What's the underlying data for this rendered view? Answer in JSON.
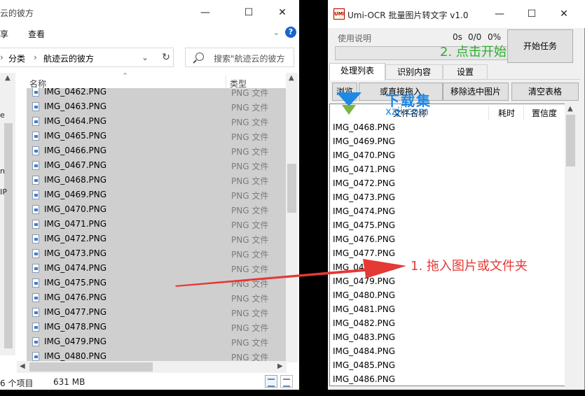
{
  "explorer": {
    "title": "云的彼方",
    "menu": [
      "享",
      "查看"
    ],
    "breadcrumb": [
      "分类",
      "航迹云的彼方"
    ],
    "refresh_icon": "refresh-icon",
    "search_placeholder": "搜索\"航迹云的彼方",
    "left_fragments": [
      "e",
      "n",
      "IP"
    ],
    "columns": {
      "name": "名称",
      "type": "类型"
    },
    "partial_top_row": "IMG_0462.PNG",
    "rows": [
      {
        "name": "IMG_0463.PNG",
        "type": "PNG 文件"
      },
      {
        "name": "IMG_0464.PNG",
        "type": "PNG 文件"
      },
      {
        "name": "IMG_0465.PNG",
        "type": "PNG 文件"
      },
      {
        "name": "IMG_0466.PNG",
        "type": "PNG 文件"
      },
      {
        "name": "IMG_0467.PNG",
        "type": "PNG 文件"
      },
      {
        "name": "IMG_0468.PNG",
        "type": "PNG 文件"
      },
      {
        "name": "IMG_0469.PNG",
        "type": "PNG 文件"
      },
      {
        "name": "IMG_0470.PNG",
        "type": "PNG 文件"
      },
      {
        "name": "IMG_0471.PNG",
        "type": "PNG 文件"
      },
      {
        "name": "IMG_0472.PNG",
        "type": "PNG 文件"
      },
      {
        "name": "IMG_0473.PNG",
        "type": "PNG 文件"
      },
      {
        "name": "IMG_0474.PNG",
        "type": "PNG 文件"
      },
      {
        "name": "IMG_0475.PNG",
        "type": "PNG 文件"
      },
      {
        "name": "IMG_0476.PNG",
        "type": "PNG 文件"
      },
      {
        "name": "IMG_0477.PNG",
        "type": "PNG 文件"
      },
      {
        "name": "IMG_0478.PNG",
        "type": "PNG 文件"
      },
      {
        "name": "IMG_0479.PNG",
        "type": "PNG 文件"
      },
      {
        "name": "IMG_0480.PNG",
        "type": "PNG 文件"
      }
    ],
    "status_count": "6 个项目",
    "status_size": "631 MB"
  },
  "umi": {
    "title": "Umi-OCR 批量图片转文字 v1.0",
    "logo_text": "UMI",
    "help_label": "使用说明",
    "time": "0s",
    "count": "0/0",
    "percent": "0%",
    "progress": 0,
    "start_button": "开始任务",
    "tabs": [
      "处理列表",
      "识别内容",
      "设置"
    ],
    "buttons": [
      "浏览",
      "或直接拖入",
      "移除选中图片",
      "清空表格"
    ],
    "table_headers": {
      "file": "文件名称",
      "time": "耗时",
      "confidence": "置信度"
    },
    "rows": [
      "IMG_0468.PNG",
      "IMG_0469.PNG",
      "IMG_0470.PNG",
      "IMG_0471.PNG",
      "IMG_0472.PNG",
      "IMG_0473.PNG",
      "IMG_0474.PNG",
      "IMG_0475.PNG",
      "IMG_0476.PNG",
      "IMG_0477.PNG",
      "IMG_0478.PNG",
      "IMG_0479.PNG",
      "IMG_0480.PNG",
      "IMG_0481.PNG",
      "IMG_0482.PNG",
      "IMG_0483.PNG",
      "IMG_0484.PNG",
      "IMG_0485.PNG",
      "IMG_0486.PNG"
    ]
  },
  "watermark": {
    "text": "下载集",
    "sub": "xzji.com"
  },
  "annotations": {
    "step1": "1. 拖入图片或文件夹",
    "step2": "2. 点击开始",
    "step1_color": "#e53935",
    "step2_color": "#2eae2e"
  }
}
